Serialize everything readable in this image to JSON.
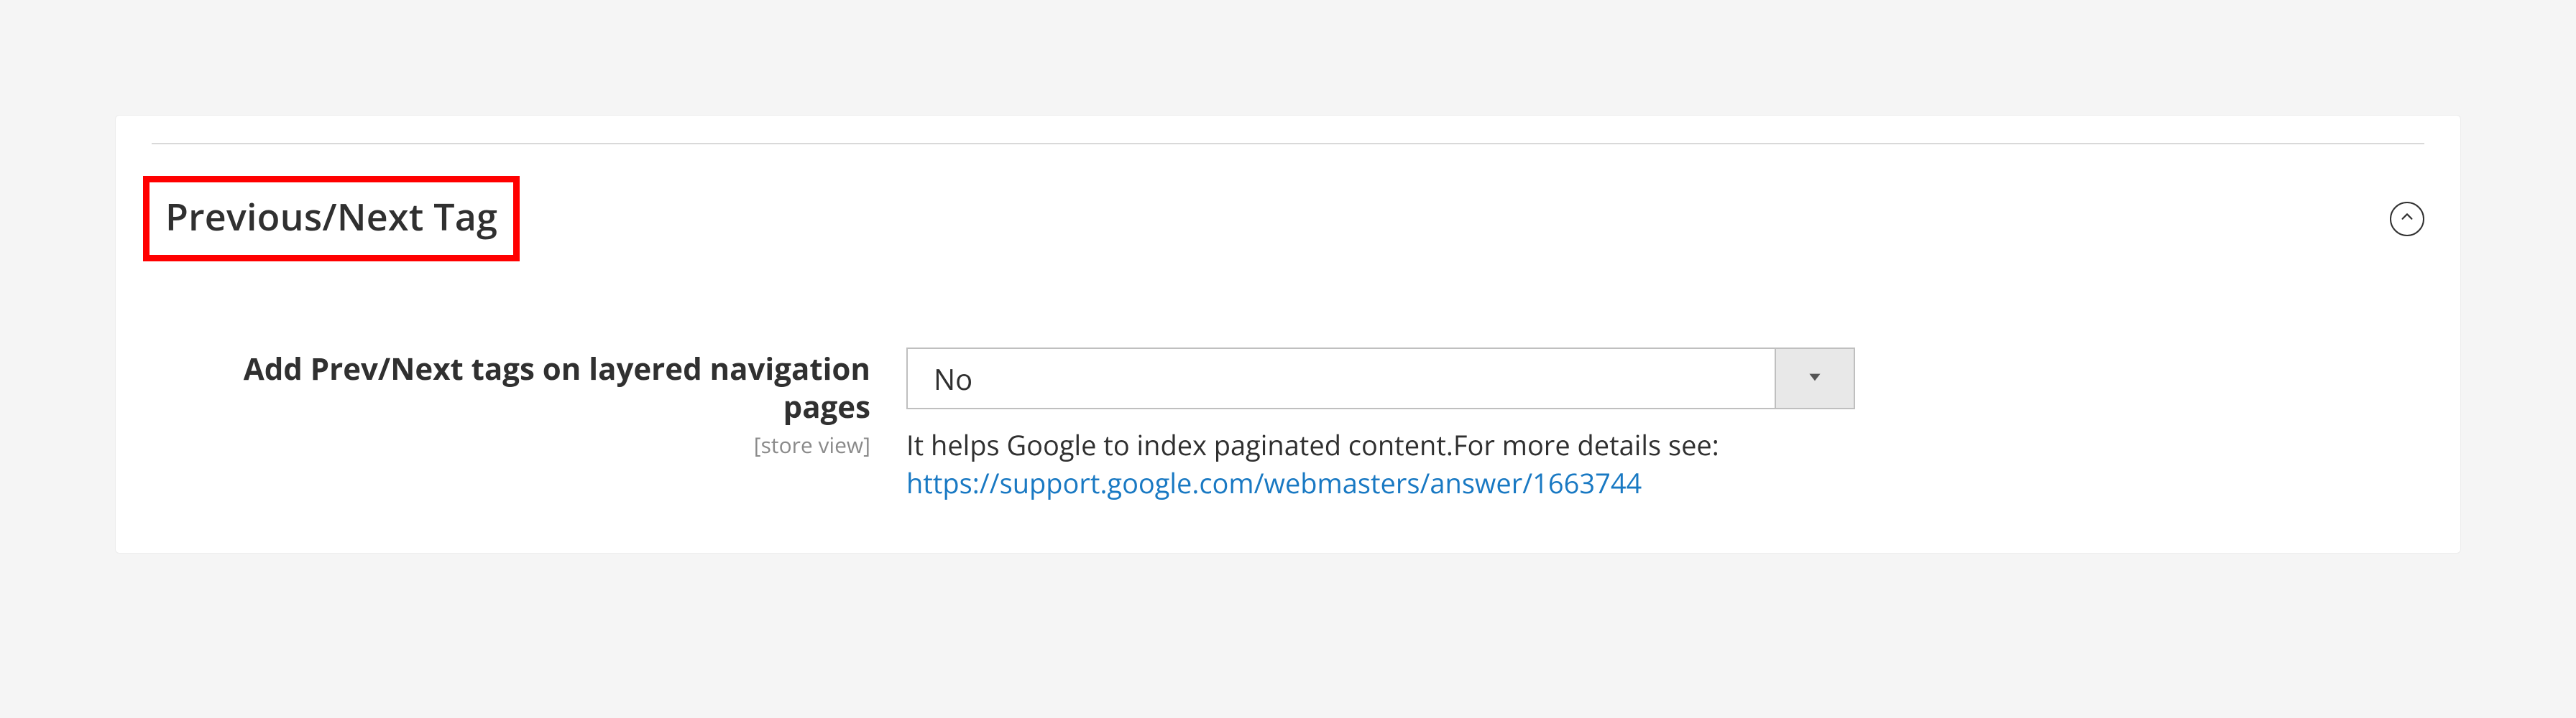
{
  "section": {
    "title": "Previous/Next Tag"
  },
  "field": {
    "label": "Add Prev/Next tags on layered navigation pages",
    "scope": "[store view]",
    "value": "No",
    "help_text_prefix": "It helps Google to index paginated content.For more details see:",
    "help_link_text": "https://support.google.com/webmasters/answer/1663744"
  }
}
